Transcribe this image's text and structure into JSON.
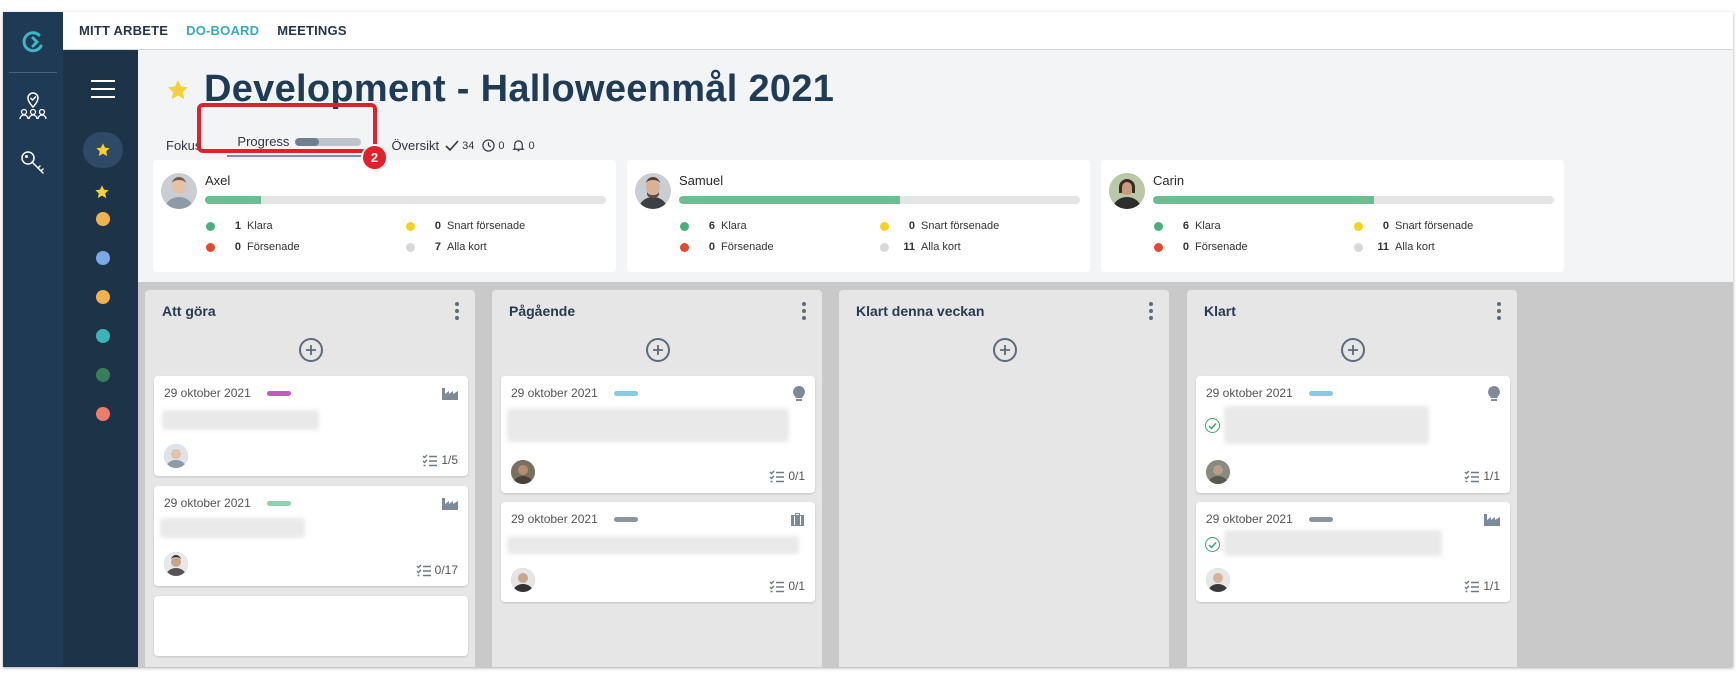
{
  "nav": {
    "items": [
      {
        "label": "MITT ARBETE",
        "active": false
      },
      {
        "label": "DO-BOARD",
        "active": true
      },
      {
        "label": "MEETINGS",
        "active": false
      }
    ]
  },
  "header": {
    "title": "Development - Halloweenmål 2021",
    "tabs": {
      "fokus": "Fokus",
      "progress": "Progress",
      "progress_fraction": 0.35,
      "oversikt": "Översikt",
      "done_count": "34",
      "time_count": "0",
      "bell_count": "0"
    },
    "annotation_badge": "2"
  },
  "sidebar": {
    "colors": [
      "#f0b24f",
      "#7aa9e8",
      "#f0b24f",
      "#3bb5b5",
      "#3a7d5c",
      "#ee7b6b"
    ]
  },
  "people": [
    {
      "name": "Axel",
      "progress": 0.14,
      "klara": "1",
      "klara_label": "Klara",
      "snart": "0",
      "snart_label": "Snart försenade",
      "forsenade": "0",
      "forsenade_label": "Försenade",
      "alla": "7",
      "alla_label": "Alla kort"
    },
    {
      "name": "Samuel",
      "progress": 0.55,
      "klara": "6",
      "klara_label": "Klara",
      "snart": "0",
      "snart_label": "Snart försenade",
      "forsenade": "0",
      "forsenade_label": "Försenade",
      "alla": "11",
      "alla_label": "Alla kort"
    },
    {
      "name": "Carin",
      "progress": 0.55,
      "klara": "6",
      "klara_label": "Klara",
      "snart": "0",
      "snart_label": "Snart försenade",
      "forsenade": "0",
      "forsenade_label": "Försenade",
      "alla": "11",
      "alla_label": "Alla kort"
    }
  ],
  "board": {
    "columns": [
      {
        "title": "Att göra",
        "cards": [
          {
            "date": "29 oktober 2021",
            "tag_color": "#c559c2",
            "icon": "factory-icon",
            "checklist": "1/5",
            "done": false
          },
          {
            "date": "29 oktober 2021",
            "tag_color": "#8fd1a9",
            "icon": "factory-icon",
            "checklist": "0/17",
            "done": false
          }
        ]
      },
      {
        "title": "Pågående",
        "cards": [
          {
            "date": "29 oktober 2021",
            "tag_color": "#88cbe6",
            "icon": "lightbulb-icon",
            "checklist": "0/1",
            "done": false
          },
          {
            "date": "29 oktober 2021",
            "tag_color": "#8a97a3",
            "icon": "briefcase-icon",
            "checklist": "0/1",
            "done": false
          }
        ]
      },
      {
        "title": "Klart denna veckan",
        "cards": []
      },
      {
        "title": "Klart",
        "cards": [
          {
            "date": "29 oktober 2021",
            "tag_color": "#88cbe6",
            "icon": "lightbulb-icon",
            "checklist": "1/1",
            "done": true
          },
          {
            "date": "29 oktober 2021",
            "tag_color": "#8a97a3",
            "icon": "factory-icon",
            "checklist": "1/1",
            "done": true
          }
        ]
      }
    ]
  }
}
